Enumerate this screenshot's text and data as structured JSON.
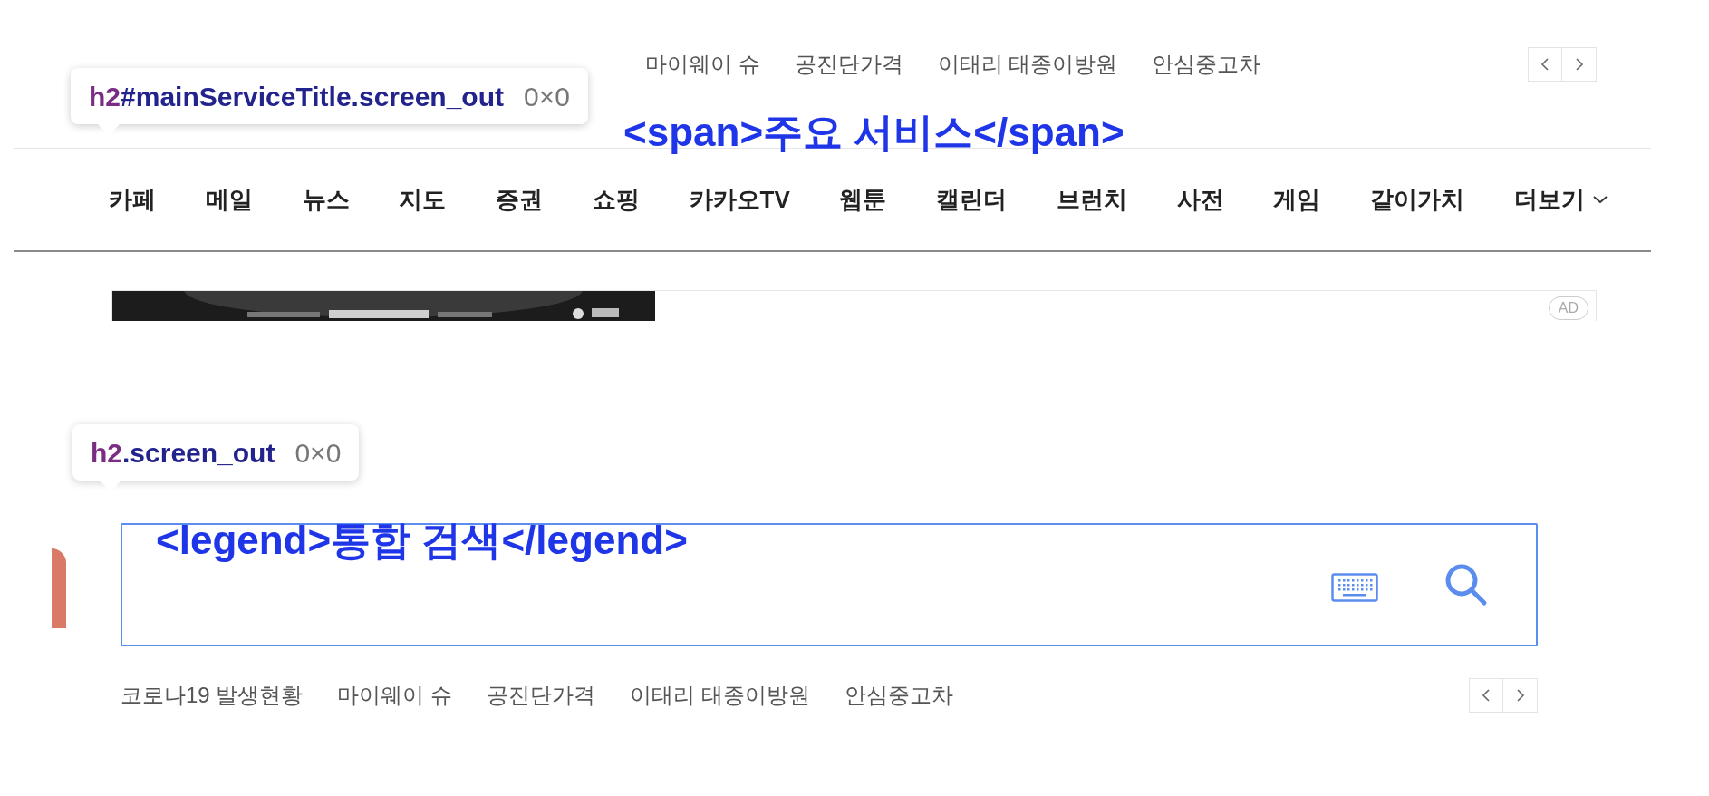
{
  "top_section": {
    "trending_keywords": [
      "마이웨이 슈",
      "공진단가격",
      "이태리 태종이방원",
      "안심중고차"
    ],
    "inspector_tooltip": {
      "tag": "h2",
      "selector": "#mainServiceTitle.screen_out",
      "size": "0×0"
    },
    "source_overlay": "<span>주요 서비스</span>",
    "services": [
      {
        "label": "카페",
        "kind": "link"
      },
      {
        "label": "메일",
        "kind": "link"
      },
      {
        "label": "뉴스",
        "kind": "link"
      },
      {
        "label": "지도",
        "kind": "link"
      },
      {
        "label": "증권",
        "kind": "link"
      },
      {
        "label": "쇼핑",
        "kind": "link"
      },
      {
        "label": "카카오TV",
        "kind": "link"
      },
      {
        "label": "웹툰",
        "kind": "link"
      },
      {
        "label": "캘린더",
        "kind": "link"
      },
      {
        "label": "브런치",
        "kind": "link"
      },
      {
        "label": "사전",
        "kind": "link"
      },
      {
        "label": "게임",
        "kind": "link"
      },
      {
        "label": "같이가치",
        "kind": "link"
      },
      {
        "label": "더보기",
        "kind": "more"
      }
    ],
    "ad": {
      "badge": "AD"
    }
  },
  "bottom_section": {
    "inspector_tooltip": {
      "tag": "h2",
      "selector": ".screen_out",
      "size": "0×0"
    },
    "source_overlay": "<legend>통합 검색</legend>",
    "trending_keywords": [
      "코로나19 발생현황",
      "마이웨이 슈",
      "공진단가격",
      "이태리 태종이방원",
      "안심중고차"
    ]
  }
}
